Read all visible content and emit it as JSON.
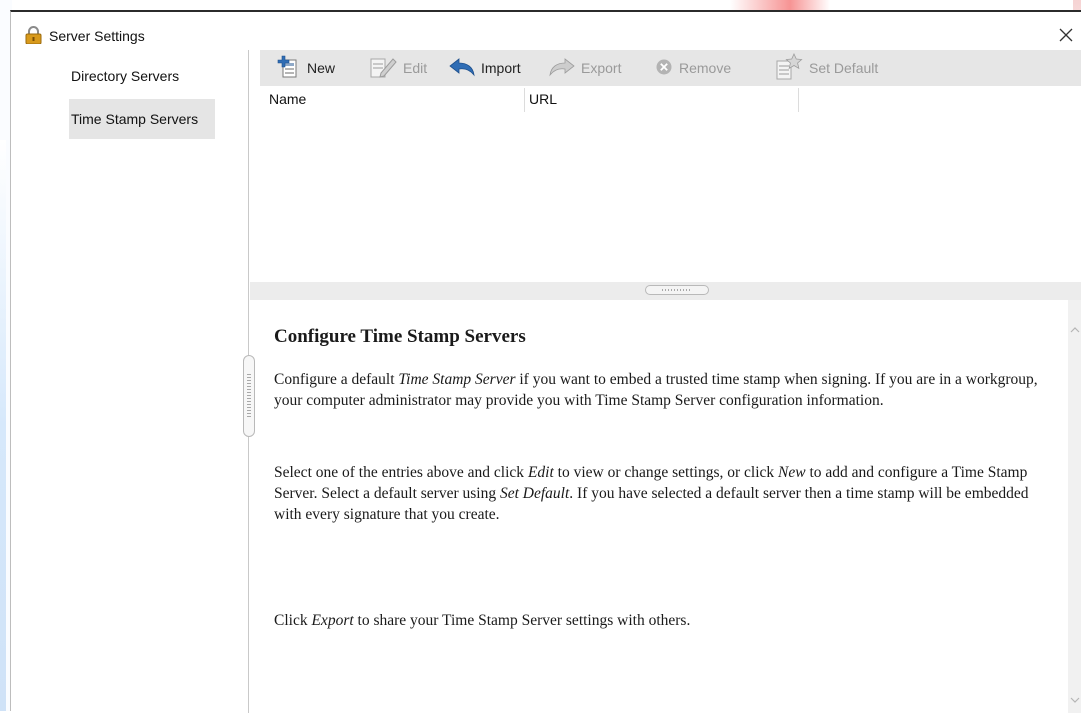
{
  "window": {
    "title": "Server Settings",
    "close_glyph": "×"
  },
  "sidebar": {
    "items": [
      {
        "label": "Directory Servers",
        "selected": false
      },
      {
        "label": "Time Stamp Servers",
        "selected": true
      }
    ]
  },
  "toolbar": {
    "buttons": [
      {
        "label": "New",
        "icon": "new-icon",
        "enabled": true
      },
      {
        "label": "Edit",
        "icon": "edit-icon",
        "enabled": false
      },
      {
        "label": "Import",
        "icon": "import-icon",
        "enabled": true
      },
      {
        "label": "Export",
        "icon": "export-icon",
        "enabled": false
      },
      {
        "label": "Remove",
        "icon": "remove-icon",
        "enabled": false
      },
      {
        "label": "Set Default",
        "icon": "set-default-icon",
        "enabled": false
      }
    ]
  },
  "table": {
    "columns": [
      "Name",
      "URL"
    ],
    "rows": []
  },
  "help": {
    "title": "Configure Time Stamp Servers",
    "p1": [
      "Configure a default ",
      "Time Stamp Server",
      " if you want to embed a trusted time stamp when signing. If you are in a workgroup, your computer administrator may provide you with Time Stamp Server configuration information."
    ],
    "p2": [
      "Select one of the entries above and click ",
      "Edit",
      " to view or change settings, or click ",
      "New",
      " to add and configure a Time Stamp Server. Select a default server using ",
      "Set Default",
      ". If you have selected a default server then a time stamp will be embedded with every signature that you create."
    ],
    "p3": [
      "Click ",
      "Export",
      " to share your Time Stamp Server settings with others."
    ]
  },
  "colors": {
    "toolbar_bg": "#e6e6e6",
    "sidebar_selected_bg": "#e5e5e5",
    "icon_blue": "#2f6db5",
    "lock_gold": "#d89a1c"
  }
}
